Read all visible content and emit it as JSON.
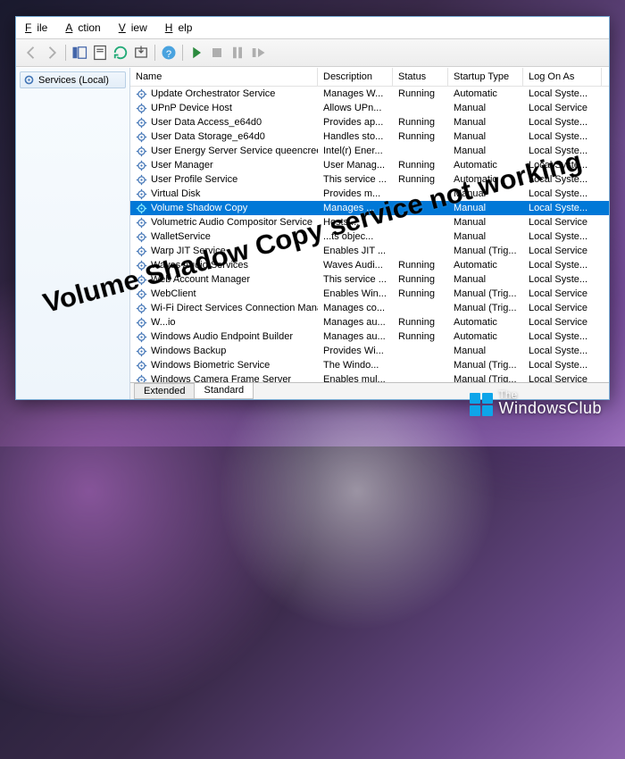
{
  "menubar": {
    "file": "File",
    "action": "Action",
    "view": "View",
    "help": "Help"
  },
  "toolbar": {
    "icons": [
      "back",
      "forward",
      "up",
      "show-hide-tree",
      "help",
      "refresh",
      "export",
      "properties",
      "play",
      "stop",
      "pause",
      "restart"
    ]
  },
  "sidebar": {
    "items": [
      {
        "label": "Services (Local)"
      }
    ]
  },
  "columns": {
    "name": "Name",
    "description": "Description",
    "status": "Status",
    "startup": "Startup Type",
    "logon": "Log On As"
  },
  "selected_index": 8,
  "services": [
    {
      "name": "Update Orchestrator Service",
      "description": "Manages W...",
      "status": "Running",
      "startup": "Automatic",
      "logon": "Local Syste..."
    },
    {
      "name": "UPnP Device Host",
      "description": "Allows UPn...",
      "status": "",
      "startup": "Manual",
      "logon": "Local Service"
    },
    {
      "name": "User Data Access_e64d0",
      "description": "Provides ap...",
      "status": "Running",
      "startup": "Manual",
      "logon": "Local Syste..."
    },
    {
      "name": "User Data Storage_e64d0",
      "description": "Handles sto...",
      "status": "Running",
      "startup": "Manual",
      "logon": "Local Syste..."
    },
    {
      "name": "User Energy Server Service queencreek",
      "description": "Intel(r) Ener...",
      "status": "",
      "startup": "Manual",
      "logon": "Local Syste..."
    },
    {
      "name": "User Manager",
      "description": "User Manag...",
      "status": "Running",
      "startup": "Automatic",
      "logon": "Local Syste..."
    },
    {
      "name": "User Profile Service",
      "description": "This service ...",
      "status": "Running",
      "startup": "Automatic",
      "logon": "Local Syste..."
    },
    {
      "name": "Virtual Disk",
      "description": "Provides m...",
      "status": "",
      "startup": "Manual",
      "logon": "Local Syste..."
    },
    {
      "name": "Volume Shadow Copy",
      "description": "Manages ...",
      "status": "",
      "startup": "Manual",
      "logon": "Local Syste..."
    },
    {
      "name": "Volumetric Audio Compositor Service",
      "description": "Hosts ...",
      "status": "",
      "startup": "Manual",
      "logon": "Local Service"
    },
    {
      "name": "WalletService",
      "description": "...ts objec...",
      "status": "",
      "startup": "Manual",
      "logon": "Local Syste..."
    },
    {
      "name": "Warp JIT Service",
      "description": "Enables JIT ...",
      "status": "",
      "startup": "Manual (Trig...",
      "logon": "Local Service"
    },
    {
      "name": "Waves Audio Services",
      "description": "Waves Audi...",
      "status": "Running",
      "startup": "Automatic",
      "logon": "Local Syste..."
    },
    {
      "name": "Web Account Manager",
      "description": "This service ...",
      "status": "Running",
      "startup": "Manual",
      "logon": "Local Syste..."
    },
    {
      "name": "WebClient",
      "description": "Enables Win...",
      "status": "Running",
      "startup": "Manual (Trig...",
      "logon": "Local Service"
    },
    {
      "name": "Wi-Fi Direct Services Connection Manager Ser...",
      "description": "Manages co...",
      "status": "",
      "startup": "Manual (Trig...",
      "logon": "Local Service"
    },
    {
      "name": "W...io",
      "description": "Manages au...",
      "status": "Running",
      "startup": "Automatic",
      "logon": "Local Service"
    },
    {
      "name": "Windows Audio Endpoint Builder",
      "description": "Manages au...",
      "status": "Running",
      "startup": "Automatic",
      "logon": "Local Syste..."
    },
    {
      "name": "Windows Backup",
      "description": "Provides Wi...",
      "status": "",
      "startup": "Manual",
      "logon": "Local Syste..."
    },
    {
      "name": "Windows Biometric Service",
      "description": "The Windo...",
      "status": "",
      "startup": "Manual (Trig...",
      "logon": "Local Syste..."
    },
    {
      "name": "Windows Camera Frame Server",
      "description": "Enables mul...",
      "status": "",
      "startup": "Manual (Trig...",
      "logon": "Local Service"
    }
  ],
  "tabs": {
    "extended": "Extended",
    "standard": "Standard"
  },
  "overlay": "Volume Shadow Copy service not working",
  "watermark": {
    "line1": "The",
    "line2": "WindowsClub"
  }
}
